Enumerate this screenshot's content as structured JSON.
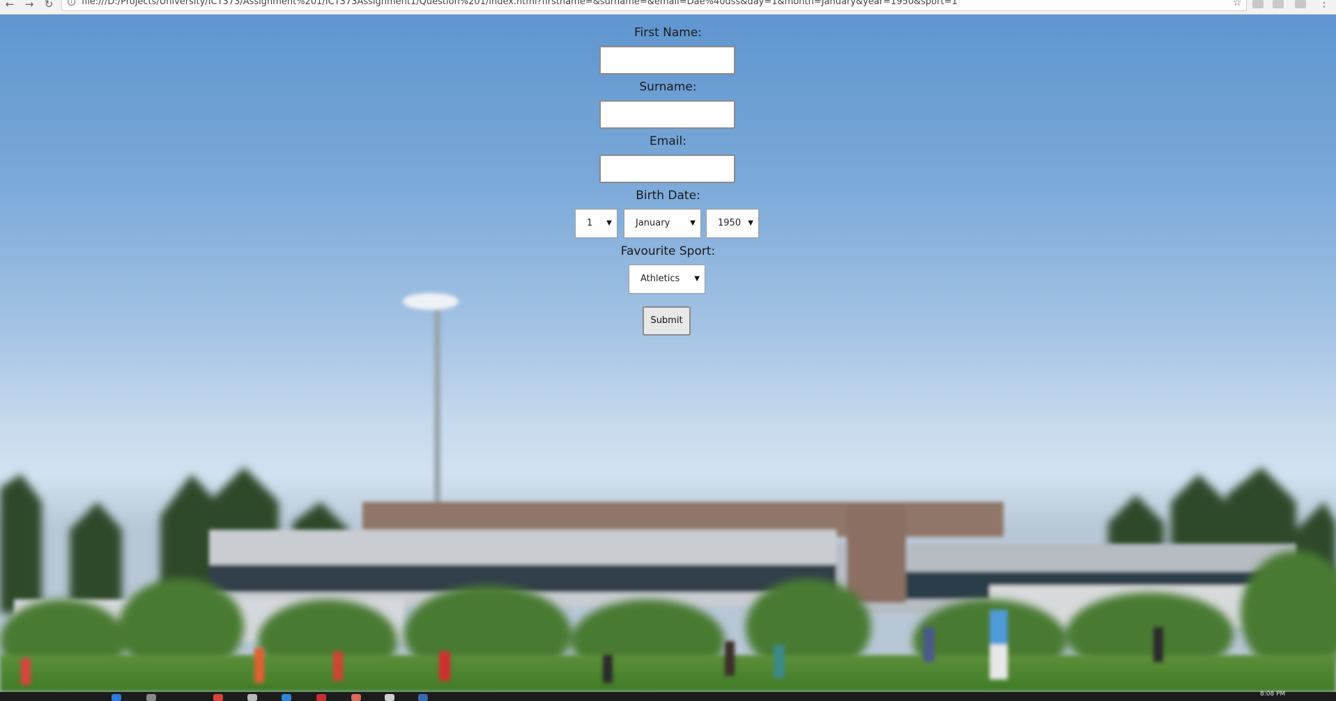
{
  "browser": {
    "url": "file:///D:/Projects/University/ICT373/Assignment%201/ICT373Assignment1/Question%201/index.html?firstname=&surname=&email=Dae%40dss&day=1&month=January&year=1950&sport=1",
    "back_icon": "back-arrow-icon",
    "forward_icon": "forward-arrow-icon",
    "reload_icon": "reload-icon",
    "bookmark_icon": "star-icon"
  },
  "form": {
    "first_name_label": "First Name:",
    "first_name_value": "",
    "surname_label": "Surname:",
    "surname_value": "",
    "email_label": "Email:",
    "email_value": "",
    "birth_date_label": "Birth Date:",
    "day_value": "1",
    "month_value": "January",
    "year_value": "1950",
    "sport_label": "Favourite Sport:",
    "sport_value": "Athletics",
    "submit_label": "Submit"
  },
  "taskbar": {
    "clock": "8:08 PM"
  },
  "colors": {
    "sky_top": "#5f95cf",
    "sky_bottom": "#d2e1f0",
    "grass": "#4f8a2c",
    "building": "#8f7668",
    "taskbar": "#1c1c1c"
  }
}
